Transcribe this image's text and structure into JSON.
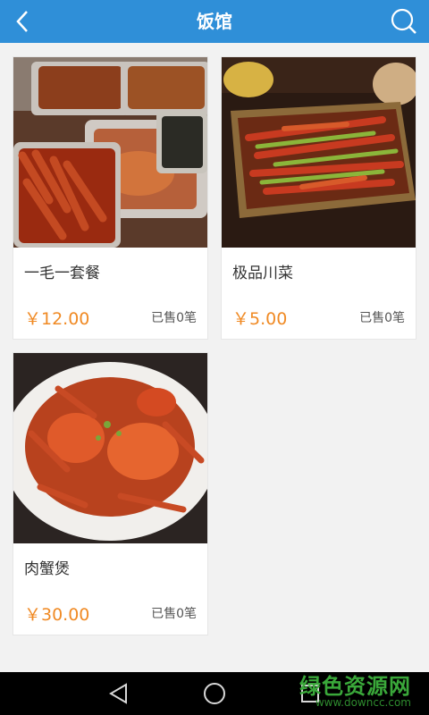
{
  "header": {
    "title": "饭馆",
    "back_icon": "chevron-left-icon",
    "search_icon": "search-icon",
    "background": "#2f8fd8"
  },
  "products": [
    {
      "name": "一毛一套餐",
      "price": "￥12.00",
      "sold": "已售0笔"
    },
    {
      "name": "极品川菜",
      "price": "￥5.00",
      "sold": "已售0笔"
    },
    {
      "name": "肉蟹煲",
      "price": "￥30.00",
      "sold": "已售0笔"
    }
  ],
  "colors": {
    "price": "#f08a24",
    "watermark": "#3aa83a"
  },
  "navbar": {
    "icons": [
      "back-triangle-icon",
      "home-circle-icon",
      "recents-square-icon"
    ]
  },
  "watermark": {
    "line1": "绿色资源网",
    "line2": "www.downcc.com"
  }
}
